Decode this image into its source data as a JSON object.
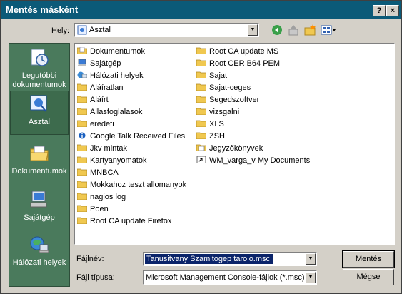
{
  "window": {
    "title": "Mentés másként",
    "help_glyph": "?",
    "close_glyph": "×"
  },
  "location": {
    "label": "Hely:",
    "value": "Asztal"
  },
  "sidebar": {
    "items": [
      {
        "label": "Legutóbbi dokumentumok",
        "icon": "recent-documents-icon"
      },
      {
        "label": "Asztal",
        "icon": "desktop-icon",
        "selected": true
      },
      {
        "label": "Dokumentumok",
        "icon": "documents-folder-icon"
      },
      {
        "label": "Sajátgép",
        "icon": "my-computer-icon"
      },
      {
        "label": "Hálózati helyek",
        "icon": "network-places-icon"
      }
    ]
  },
  "files": {
    "col1": [
      {
        "name": "Dokumentumok",
        "icon": "my-documents"
      },
      {
        "name": "Sajátgép",
        "icon": "computer"
      },
      {
        "name": "Hálózati helyek",
        "icon": "network"
      },
      {
        "name": "Aláíratlan",
        "icon": "folder"
      },
      {
        "name": "Aláírt",
        "icon": "folder"
      },
      {
        "name": "Allasfoglalasok",
        "icon": "folder"
      },
      {
        "name": "eredeti",
        "icon": "folder"
      },
      {
        "name": "Google Talk Received Files",
        "icon": "shortcut"
      },
      {
        "name": "Jkv mintak",
        "icon": "folder"
      },
      {
        "name": "Kartyanyomatok",
        "icon": "folder"
      },
      {
        "name": "MNBCA",
        "icon": "folder"
      },
      {
        "name": "Mokkahoz teszt allomanyok",
        "icon": "folder"
      },
      {
        "name": "nagios log",
        "icon": "folder"
      },
      {
        "name": "Poen",
        "icon": "folder"
      },
      {
        "name": "Root CA update Firefox",
        "icon": "folder"
      }
    ],
    "col2": [
      {
        "name": "Root CA update MS",
        "icon": "folder"
      },
      {
        "name": "Root CER B64 PEM",
        "icon": "folder"
      },
      {
        "name": "Sajat",
        "icon": "folder"
      },
      {
        "name": "Sajat-ceges",
        "icon": "folder"
      },
      {
        "name": "Segedszoftver",
        "icon": "folder"
      },
      {
        "name": "vizsgalni",
        "icon": "folder"
      },
      {
        "name": "XLS",
        "icon": "folder"
      },
      {
        "name": "ZSH",
        "icon": "folder"
      },
      {
        "name": "Jegyzőkönyvek",
        "icon": "doc-folder"
      },
      {
        "name": "WM_varga_v My Documents",
        "icon": "shortcut-folder"
      }
    ]
  },
  "filename": {
    "label": "Fájlnév:",
    "value": "Tanusitvany Szamitogep tarolo.msc"
  },
  "filetype": {
    "label": "Fájl típusa:",
    "value": "Microsoft Management Console-fájlok (*.msc)"
  },
  "buttons": {
    "save": "Mentés",
    "cancel": "Mégse"
  },
  "colors": {
    "titlebar": "#0b5a78",
    "sidebar": "#4a7a5c",
    "selection": "#0b246a",
    "folder": "#f0c850"
  }
}
